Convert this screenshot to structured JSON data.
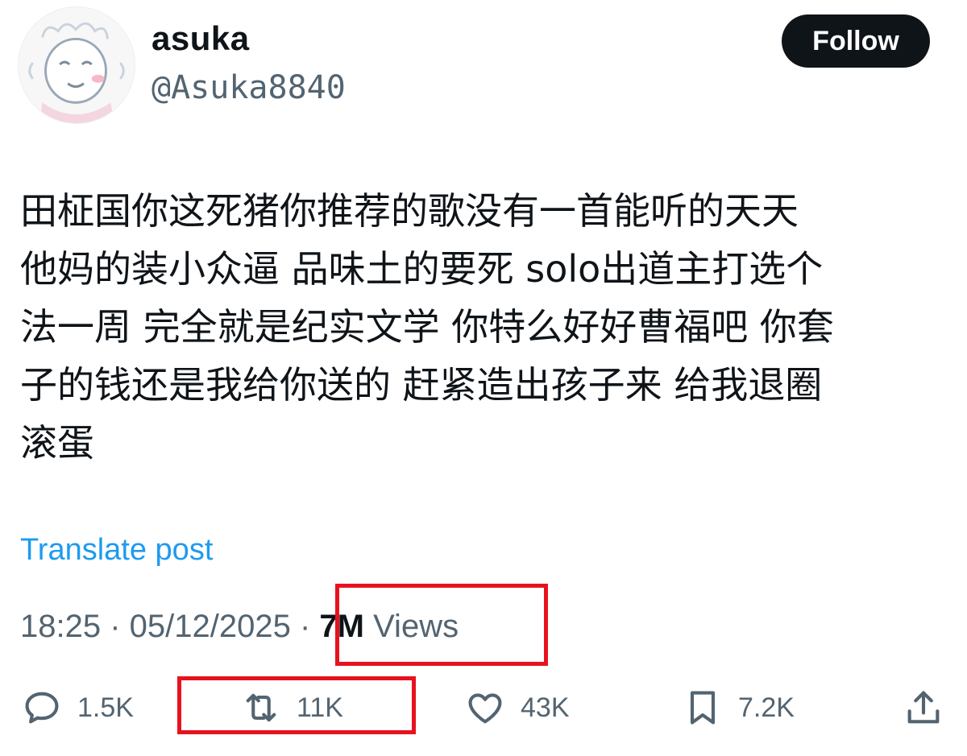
{
  "user": {
    "display_name": "asuka",
    "handle": "@Asuka8840",
    "avatar_icon": "cartoon-avatar"
  },
  "follow_button": {
    "label": "Follow"
  },
  "tweet": {
    "text": "田柾国你这死猪你推荐的歌没有一首能听的天天\n他妈的装小众逼 品味土的要死 solo出道主打选个\n法一周 完全就是纪实文学 你特么好好曹福吧 你套\n子的钱还是我给你送的 赶紧造出孩子来 给我退圈\n滚蛋",
    "translate_label": "Translate post",
    "time": "18:25",
    "separator": " · ",
    "date": "05/12/2025",
    "views_count": "7M",
    "views_label": " Views"
  },
  "actions": {
    "reply": {
      "icon": "reply-icon",
      "count": "1.5K"
    },
    "retweet": {
      "icon": "retweet-icon",
      "count": "11K"
    },
    "like": {
      "icon": "heart-icon",
      "count": "43K"
    },
    "bookmark": {
      "icon": "bookmark-icon",
      "count": "7.2K"
    },
    "share": {
      "icon": "share-icon"
    }
  },
  "colors": {
    "link": "#1d9bf0",
    "secondary_text": "#536471",
    "primary_text": "#0f1419",
    "highlight_box": "#e8121f"
  }
}
